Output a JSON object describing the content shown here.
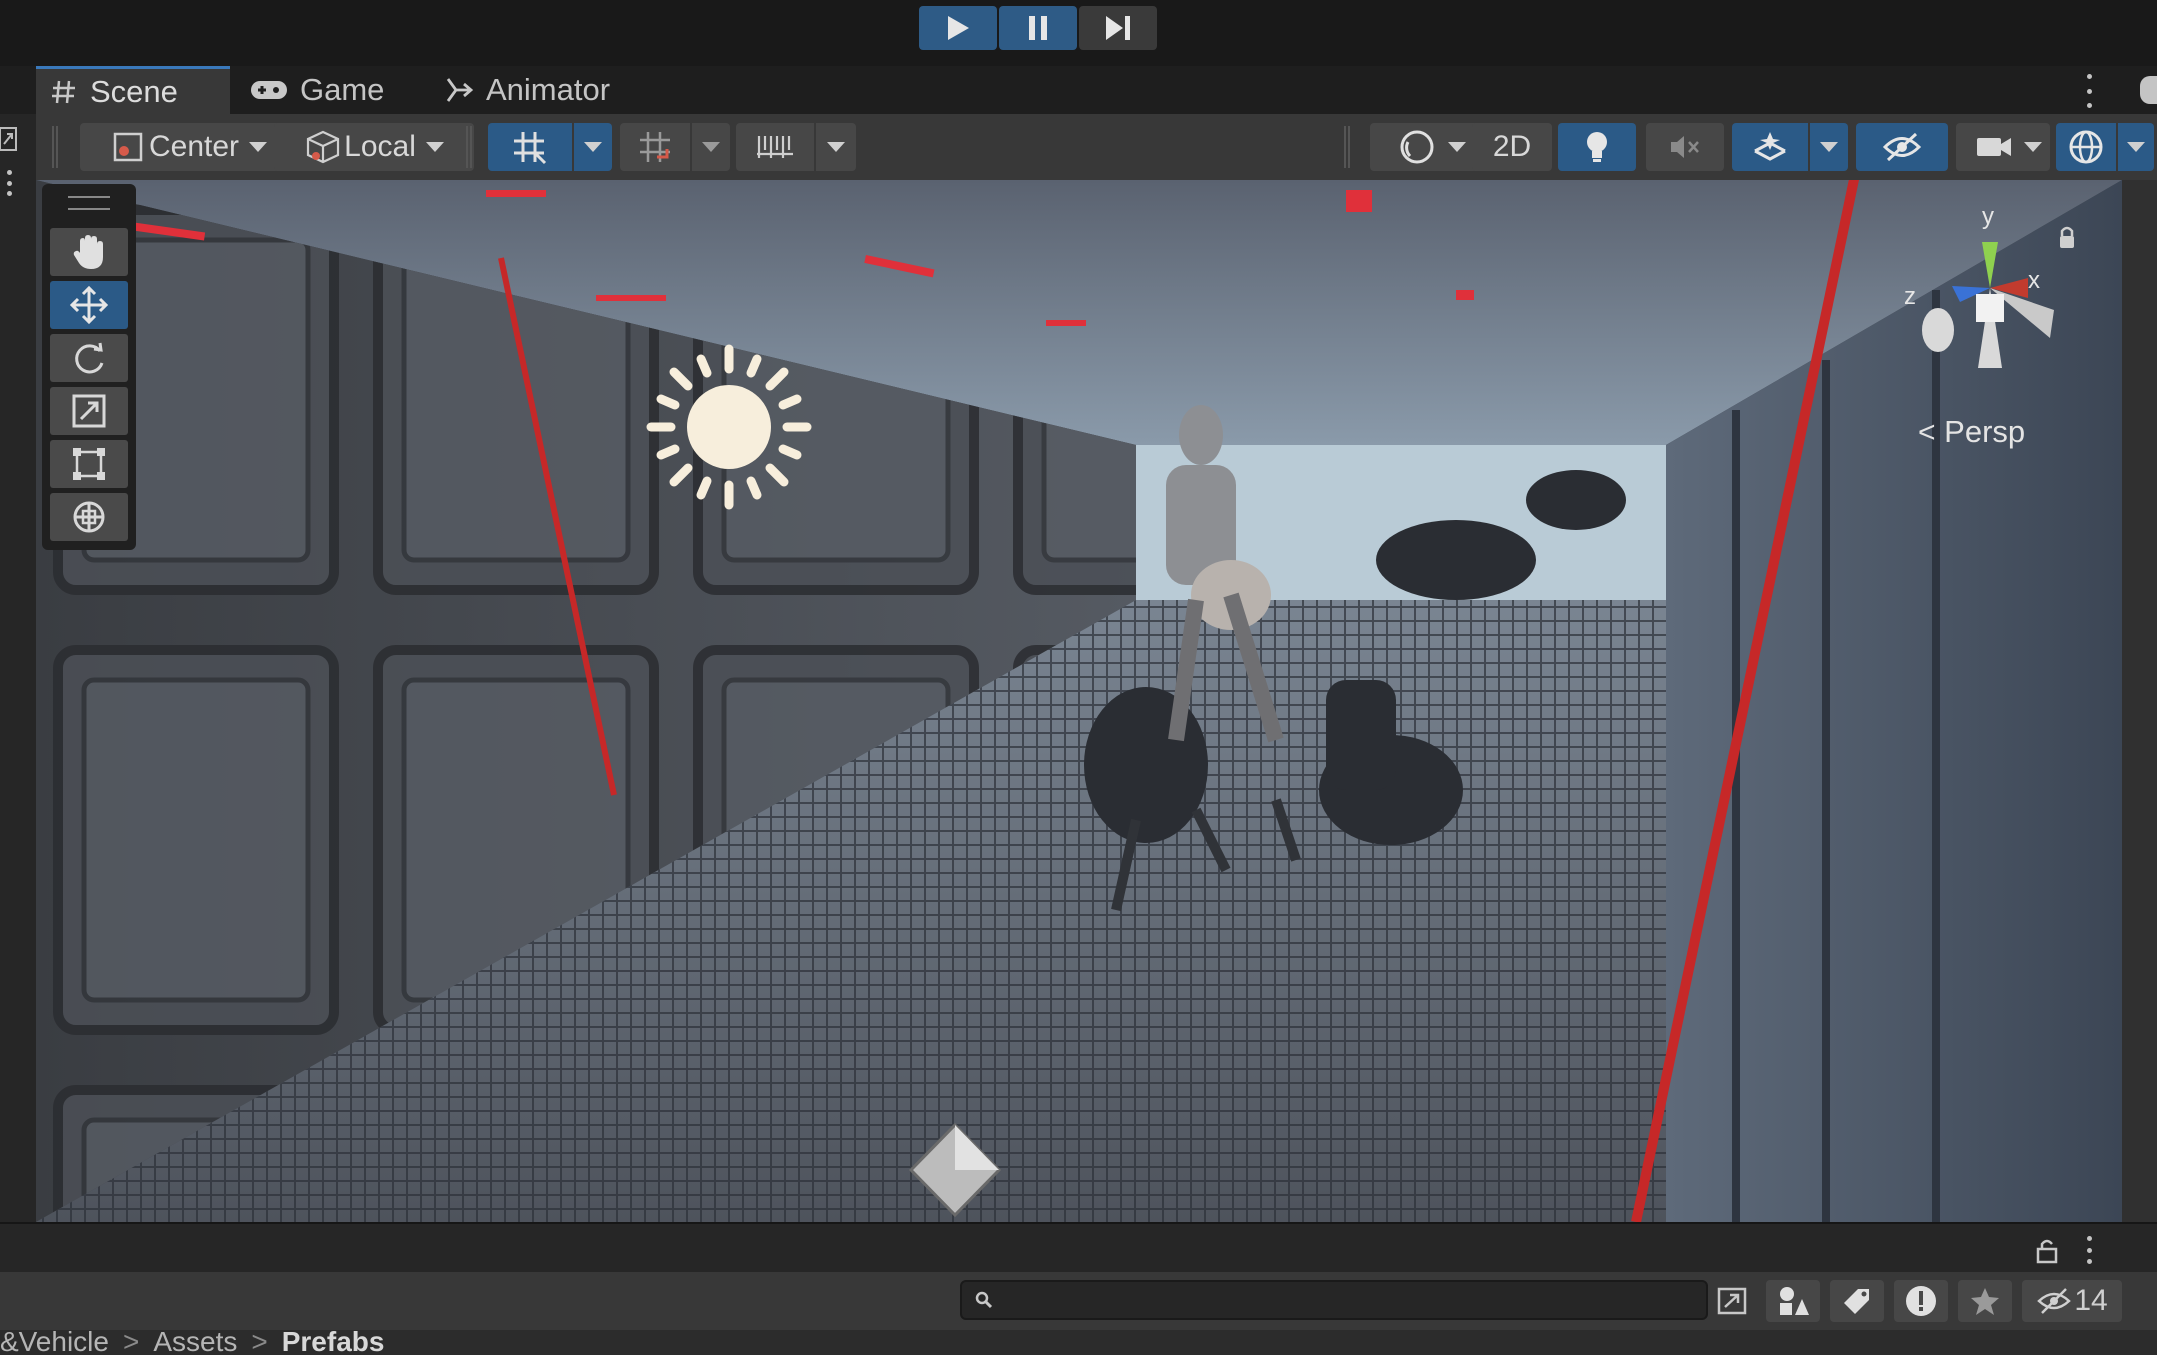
{
  "tabs": [
    {
      "label": "Scene",
      "icon": "hash-icon"
    },
    {
      "label": "Game",
      "icon": "gamepad-icon"
    },
    {
      "label": "Animator",
      "icon": "animator-icon"
    }
  ],
  "toolbar": {
    "pivot_label": "Center",
    "space_label": "Local",
    "mode_2d_label": "2D"
  },
  "viewport": {
    "projection_label": "Persp",
    "axis_x": "x",
    "axis_y": "y",
    "axis_z": "z"
  },
  "bottom": {
    "hidden_count": "14",
    "breadcrumb": [
      {
        "label": "&Vehicle",
        "bold": false
      },
      {
        "label": "Assets",
        "bold": false
      },
      {
        "label": "Prefabs",
        "bold": true
      }
    ]
  },
  "colors": {
    "accent": "#2b5a87",
    "tab_highlight": "#3a79bb",
    "panel": "#383838"
  }
}
